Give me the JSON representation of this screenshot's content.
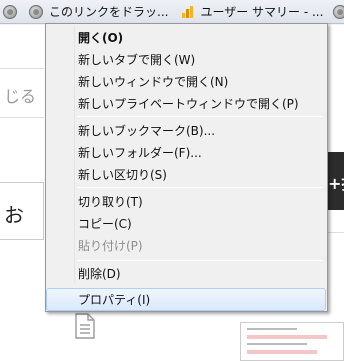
{
  "bookmarks": [
    {
      "icon": "globe-icon",
      "label": ""
    },
    {
      "icon": "globe-icon",
      "label": "このリンクをドラッ..."
    },
    {
      "icon": "chart-icon",
      "label": "ユーザー サマリー - ..."
    },
    {
      "icon": "globe-icon",
      "label": ""
    }
  ],
  "background": {
    "left_text_1": "じる",
    "left_text_2": "お",
    "right_text": "+找"
  },
  "context_menu": {
    "items": [
      {
        "label": "開く(O)",
        "bold": true
      },
      {
        "label": "新しいタブで開く(W)"
      },
      {
        "label": "新しいウィンドウで開く(N)"
      },
      {
        "label": "新しいプライベートウィンドウで開く(P)"
      },
      {
        "label": "新しいブックマーク(B)..."
      },
      {
        "label": "新しいフォルダー(F)..."
      },
      {
        "label": "新しい区切り(S)"
      },
      {
        "label": "切り取り(T)"
      },
      {
        "label": "コピー(C)"
      },
      {
        "label": "貼り付け(P)",
        "disabled": true
      },
      {
        "label": "削除(D)"
      },
      {
        "label": "プロパティ(I)",
        "hover": true
      }
    ]
  },
  "colors": {
    "menu_bg": "#f0f0f0",
    "hover_border": "#aecff7",
    "disabled_text": "#8d8d8d"
  }
}
